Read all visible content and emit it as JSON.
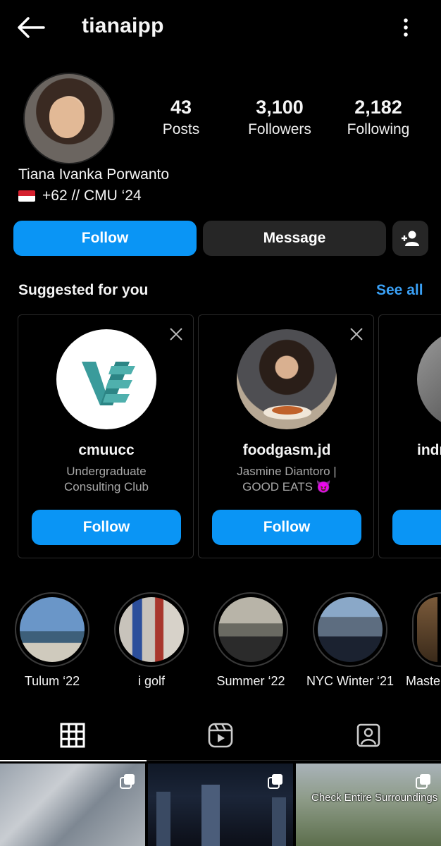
{
  "header": {
    "username": "tianaipp"
  },
  "profile": {
    "stats": [
      {
        "value": "43",
        "label": "Posts"
      },
      {
        "value": "3,100",
        "label": "Followers"
      },
      {
        "value": "2,182",
        "label": "Following"
      }
    ],
    "full_name": "Tiana Ivanka Porwanto",
    "bio": "+62 // CMU ‘24"
  },
  "actions": {
    "follow": "Follow",
    "message": "Message"
  },
  "suggested": {
    "title": "Suggested for you",
    "see_all": "See all",
    "cards": [
      {
        "username": "cmuucc",
        "subtitle_1": "Undergraduate",
        "subtitle_2": "Consulting Club",
        "button": "Follow"
      },
      {
        "username": "foodgasm.jd",
        "subtitle_1": "Jasmine Diantoro |",
        "subtitle_2": "GOOD EATS 😈",
        "button": "Follow"
      },
      {
        "username": "indr",
        "subtitle_1": "",
        "subtitle_2": "",
        "button": ""
      }
    ]
  },
  "highlights": [
    {
      "label": "Tulum ‘22"
    },
    {
      "label": "i golf"
    },
    {
      "label": "Summer ‘22"
    },
    {
      "label": "NYC Winter ‘21"
    },
    {
      "label": "Maste"
    }
  ],
  "posts": [
    {
      "caption": ""
    },
    {
      "caption": ""
    },
    {
      "caption": "Check Entire Surroundings"
    }
  ],
  "colors": {
    "accent": "#0a95f5",
    "link": "#3aa0f5",
    "button_gray": "#262626",
    "background": "#000000"
  }
}
